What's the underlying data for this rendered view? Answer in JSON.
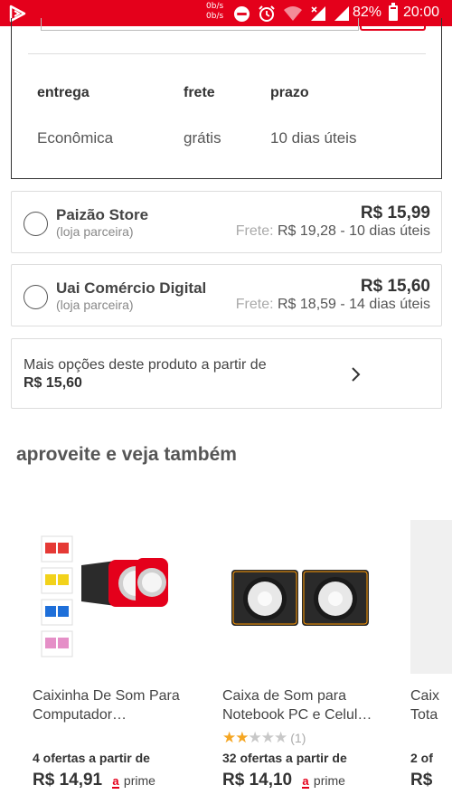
{
  "status_bar": {
    "net_up": "0b/s",
    "net_down": "0b/s",
    "battery": "82%",
    "battery_level": 0.82,
    "time": "20:00",
    "color": "#e4001b"
  },
  "shipping": {
    "headers": {
      "delivery": "entrega",
      "freight": "frete",
      "deadline": "prazo"
    },
    "row": {
      "delivery": "Econômica",
      "freight": "grátis",
      "deadline": "10 dias úteis"
    }
  },
  "sellers": [
    {
      "name": "Paizão Store",
      "tag": "(loja parceira)",
      "price": "R$ 15,99",
      "ship_label": "Frete:",
      "ship_value": "R$ 19,28 - 10 dias úteis"
    },
    {
      "name": "Uai Comércio Digital",
      "tag": "(loja parceira)",
      "price": "R$ 15,60",
      "ship_label": "Frete:",
      "ship_value": "R$ 18,59 - 14 dias úteis"
    }
  ],
  "more_options": {
    "text": "Mais opções deste produto a partir de",
    "price": "R$ 15,60"
  },
  "section_title": "aproveite e veja também",
  "products": [
    {
      "title_line1": "Caixinha De Som Para",
      "title_line2": "Computador…",
      "offers": "4 ofertas a partir de",
      "price": "R$ 14,91",
      "prime_badge": "a",
      "prime_text": "prime"
    },
    {
      "title_line1": "Caixa de Som para",
      "title_line2": "Notebook PC e Celul…",
      "rating": 2,
      "rating_max": 5,
      "rating_count": "(1)",
      "offers": "32 ofertas a partir de",
      "price": "R$ 14,10",
      "prime_badge": "a",
      "prime_text": "prime"
    },
    {
      "title_line1": "Caix",
      "title_line2": "Tota",
      "offers": "2 of",
      "price": "R$"
    }
  ]
}
